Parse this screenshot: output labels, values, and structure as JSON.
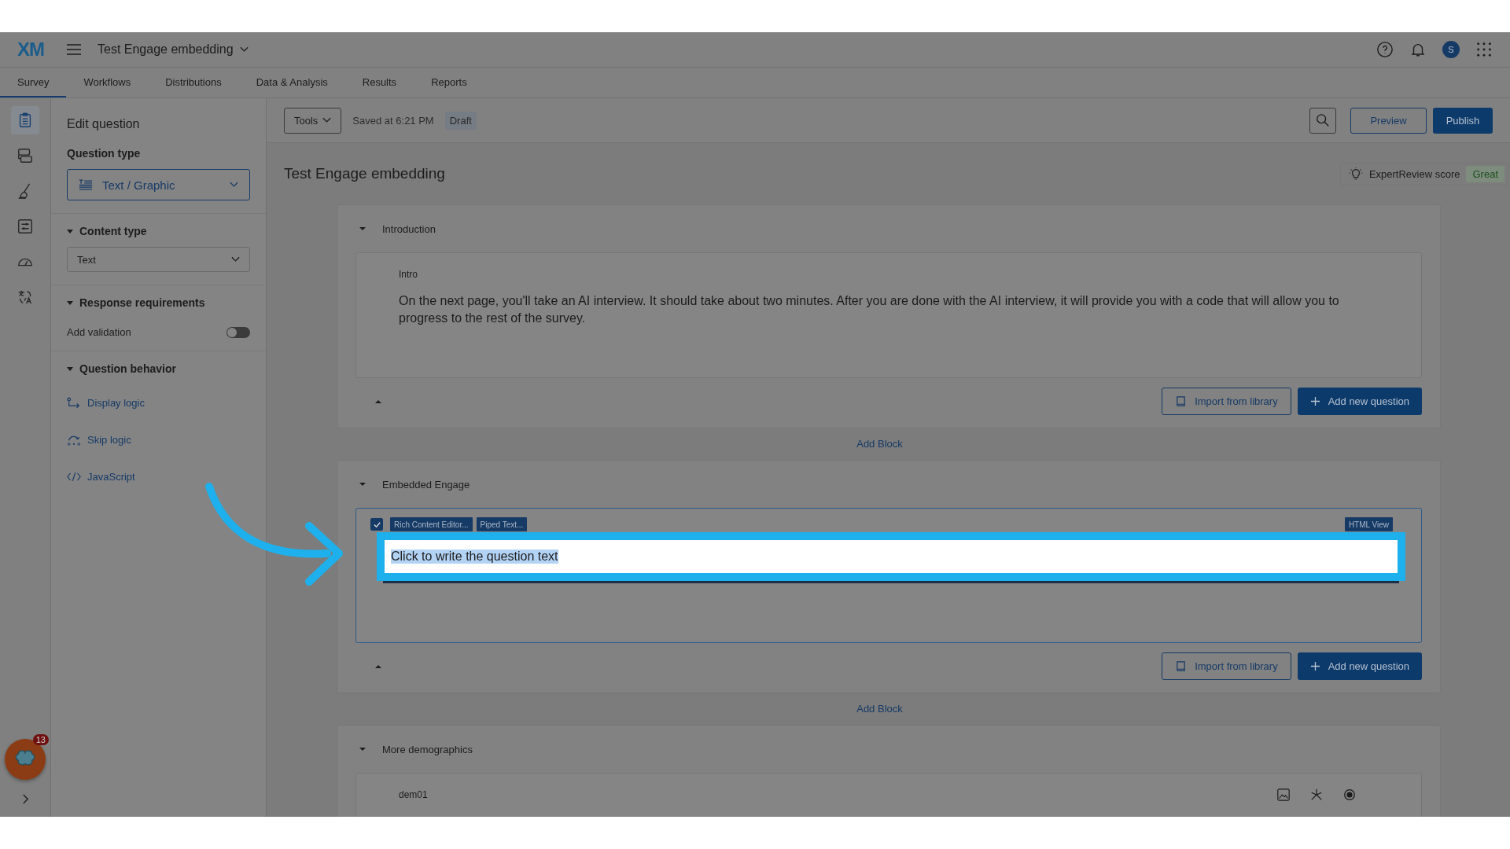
{
  "header": {
    "logo": "XM",
    "title": "Test Engage embedding",
    "avatar": "S"
  },
  "tabs": [
    {
      "label": "Survey",
      "selected": true
    },
    {
      "label": "Workflows",
      "selected": false
    },
    {
      "label": "Distributions",
      "selected": false
    },
    {
      "label": "Data & Analysis",
      "selected": false
    },
    {
      "label": "Results",
      "selected": false
    },
    {
      "label": "Reports",
      "selected": false
    }
  ],
  "rail": [
    {
      "kind": "clipboard",
      "selected": true
    },
    {
      "kind": "blocks",
      "selected": false
    },
    {
      "kind": "brush",
      "selected": false
    },
    {
      "kind": "options",
      "selected": false
    },
    {
      "kind": "gauge",
      "selected": false
    },
    {
      "kind": "translate",
      "selected": false
    }
  ],
  "side_panel": {
    "title": "Edit question",
    "question_type": {
      "label": "Question type",
      "value": "Text / Graphic"
    },
    "content_type": {
      "label": "Content type",
      "expanded": true,
      "value": "Text"
    },
    "response_requirements": {
      "label": "Response requirements",
      "expanded": true,
      "validation": {
        "label": "Add validation",
        "on": false
      }
    },
    "question_behavior": {
      "label": "Question behavior",
      "expanded": true,
      "links": [
        {
          "kind": "display",
          "label": "Display logic"
        },
        {
          "kind": "skip",
          "label": "Skip logic"
        },
        {
          "kind": "code",
          "label": "JavaScript"
        }
      ]
    }
  },
  "toolbar": {
    "tools": "Tools",
    "saved": "Saved at 6:21 PM",
    "status": "Draft",
    "preview": "Preview",
    "publish": "Publish"
  },
  "survey": {
    "title": "Test Engage embedding",
    "expert_review": {
      "label": "ExpertReview score",
      "rating": "Great"
    },
    "blocks": [
      {
        "name": "Introduction",
        "expanded": true,
        "questions": [
          {
            "kind": "text",
            "id": "Intro",
            "text": "On the next page, you'll take an AI interview. It should take about two minutes. After you are done with the AI interview, it will provide you with a code that will allow you to progress to the rest of the survey."
          }
        ],
        "import": "Import from library",
        "add": "Add new question",
        "add_block": "Add Block"
      },
      {
        "name": "Embedded Engage",
        "expanded": true,
        "questions": [
          {
            "kind": "editor",
            "checked": true,
            "tools": [
              "Rich Content Editor...",
              "Piped Text..."
            ],
            "html_view": "HTML View",
            "value": "Click to write the question text"
          }
        ],
        "import": "Import from library",
        "add": "Add new question",
        "add_block": "Add Block"
      },
      {
        "name": "More demographics",
        "expanded": true,
        "questions": [
          {
            "kind": "text",
            "id": "dem01"
          }
        ]
      }
    ]
  },
  "chat_badge": "13"
}
